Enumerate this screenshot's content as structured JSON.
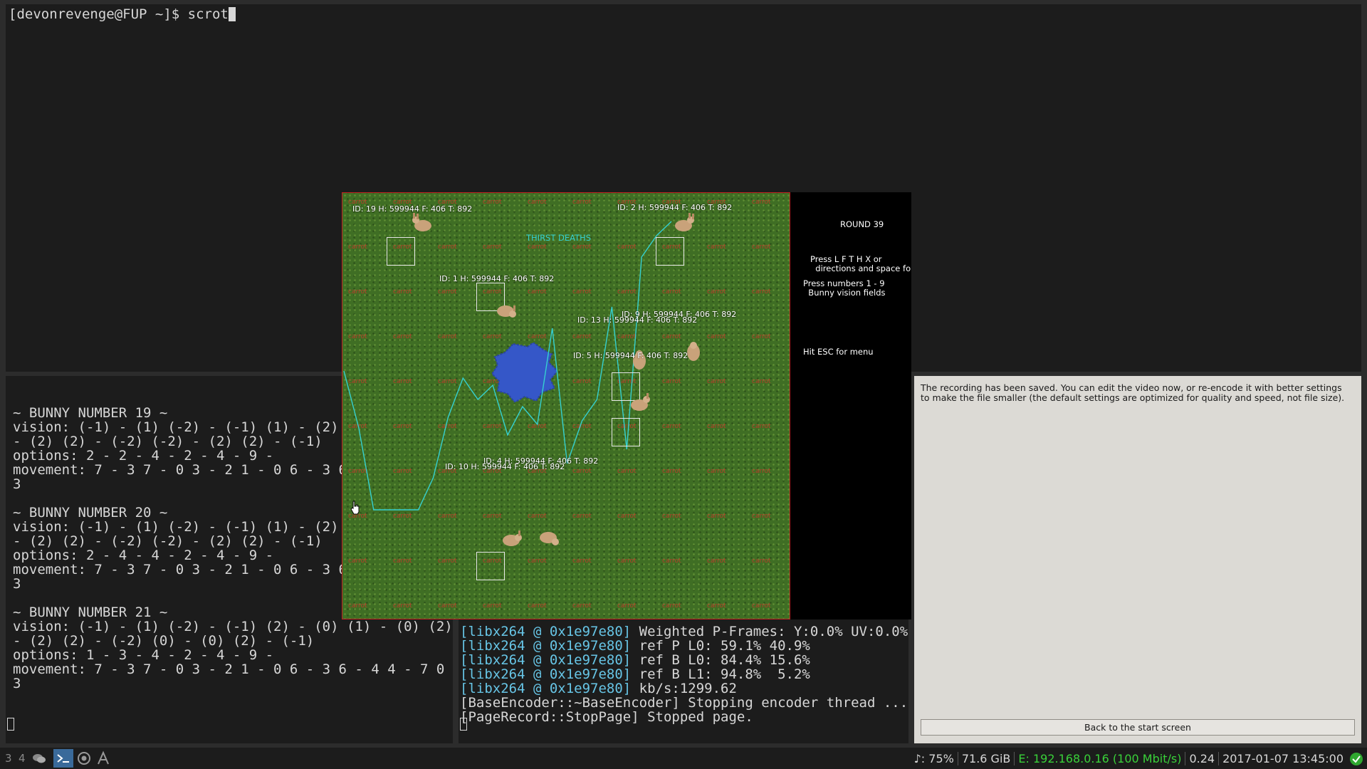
{
  "top_terminal": {
    "prompt": "[devonrevenge@FUP ~]$ scrot"
  },
  "left_terminal": {
    "bunnies": [
      {
        "header": "~ BUNNY NUMBER 19 ~",
        "vision": "vision: (-1) - (1) (-2) - (-1) (1) - (2) (",
        "vision2": "- (2) (2) - (-2) (-2) - (2) (2) - (-1)",
        "options": "options: 2 - 2 - 4 - 2 - 4 - 9 -",
        "movement": "movement: 7 - 3 7 - 0 3 - 2 1 - 0 6 - 3 6",
        "movement2": "3"
      },
      {
        "header": "~ BUNNY NUMBER 20 ~",
        "vision": "vision: (-1) - (1) (-2) - (-1) (1) - (2) (",
        "vision2": "- (2) (2) - (-2) (-2) - (2) (2) - (-1)",
        "options": "options: 2 - 4 - 4 - 2 - 4 - 9 -",
        "movement": "movement: 7 - 3 7 - 0 3 - 2 1 - 0 6 - 3 6",
        "movement2": "3"
      },
      {
        "header": "~ BUNNY NUMBER 21 ~",
        "vision": "vision: (-1) - (1) (-2) - (-1) (2) - (0) (1) - (0) (2)",
        "vision2": "- (2) (2) - (-2) (0) - (0) (2) - (-1)",
        "options": "options: 1 - 3 - 4 - 2 - 4 - 9 -",
        "movement": "movement: 7 - 3 7 - 0 3 - 2 1 - 0 6 - 3 6 - 4 4 - 7 0 -",
        "movement2": "3"
      }
    ]
  },
  "mid_terminal": {
    "lines": [
      {
        "prefix": "[libx264 @ 0x1e97e80]",
        "text": " Weighted P-Frames: Y:0.0% UV:0.0%"
      },
      {
        "prefix": "[libx264 @ 0x1e97e80]",
        "text": " ref P L0: 59.1% 40.9%"
      },
      {
        "prefix": "[libx264 @ 0x1e97e80]",
        "text": " ref B L0: 84.4% 15.6%"
      },
      {
        "prefix": "[libx264 @ 0x1e97e80]",
        "text": " ref B L1: 94.8%  5.2%"
      },
      {
        "prefix": "[libx264 @ 0x1e97e80]",
        "text": " kb/s:1299.62"
      },
      {
        "prefix": "",
        "text": "[BaseEncoder::~BaseEncoder] Stopping encoder thread ..."
      },
      {
        "prefix": "",
        "text": "[PageRecord::StopPage] Stopped page."
      }
    ]
  },
  "recorder": {
    "message": "The recording has been saved. You can edit the video now, or re-encode it with better settings to make the file smaller (the default settings are optimized for quality and speed, not file size).",
    "back_button": "Back to the start screen"
  },
  "game": {
    "carrot_label": "carrot",
    "thirst_label": "THIRST DEATHS",
    "round": "ROUND 39",
    "help_keys": "Press L F T H X or\n  directions and space fo",
    "help_numbers": "Press numbers 1 - 9\n  Bunny vision fields",
    "esc_hint": "Hit ESC for menu",
    "bunny_labels": [
      "ID: 19 H: 599944 F: 406 T: 892",
      "ID: 2 H: 599944 F: 406 T: 892",
      "ID: 1 H: 599944 F: 406 T: 892",
      "ID: 9 H: 599944 F: 406 T: 892",
      "ID: 13 H: 599944 F: 406 T: 892",
      "ID: 5 H: 599944 F: 406 T: 892",
      "ID: 4 H: 599944 F: 406 T: 892",
      "ID: 10 H: 599944 F: 406 T: 892"
    ],
    "thirst_series": [
      250,
      330,
      445,
      445,
      445,
      445,
      400,
      315,
      260,
      290,
      270,
      340,
      300,
      325,
      190,
      380,
      320,
      290,
      160,
      360,
      90,
      60,
      40
    ]
  },
  "taskbar": {
    "workspaces": [
      "3",
      "4"
    ],
    "volume": "♪: 75%",
    "disk": "71.6 GiB",
    "network": "E: 192.168.0.16 (100 Mbit/s)",
    "load": "0.24",
    "datetime": "2017-01-07 13:45:00"
  },
  "colors": {
    "terminal_bg": "#1c1c1c",
    "terminal_fg": "#d7d7d7",
    "libx264_prefix": "#67c5e6",
    "network_ok": "#39d139",
    "thirst_line": "#35d0d0",
    "field_border": "#c02020"
  },
  "icons": [
    "chat-icon",
    "terminal-icon",
    "browser-icon",
    "font-icon",
    "ok-check-icon",
    "mouse-pointer-icon"
  ]
}
